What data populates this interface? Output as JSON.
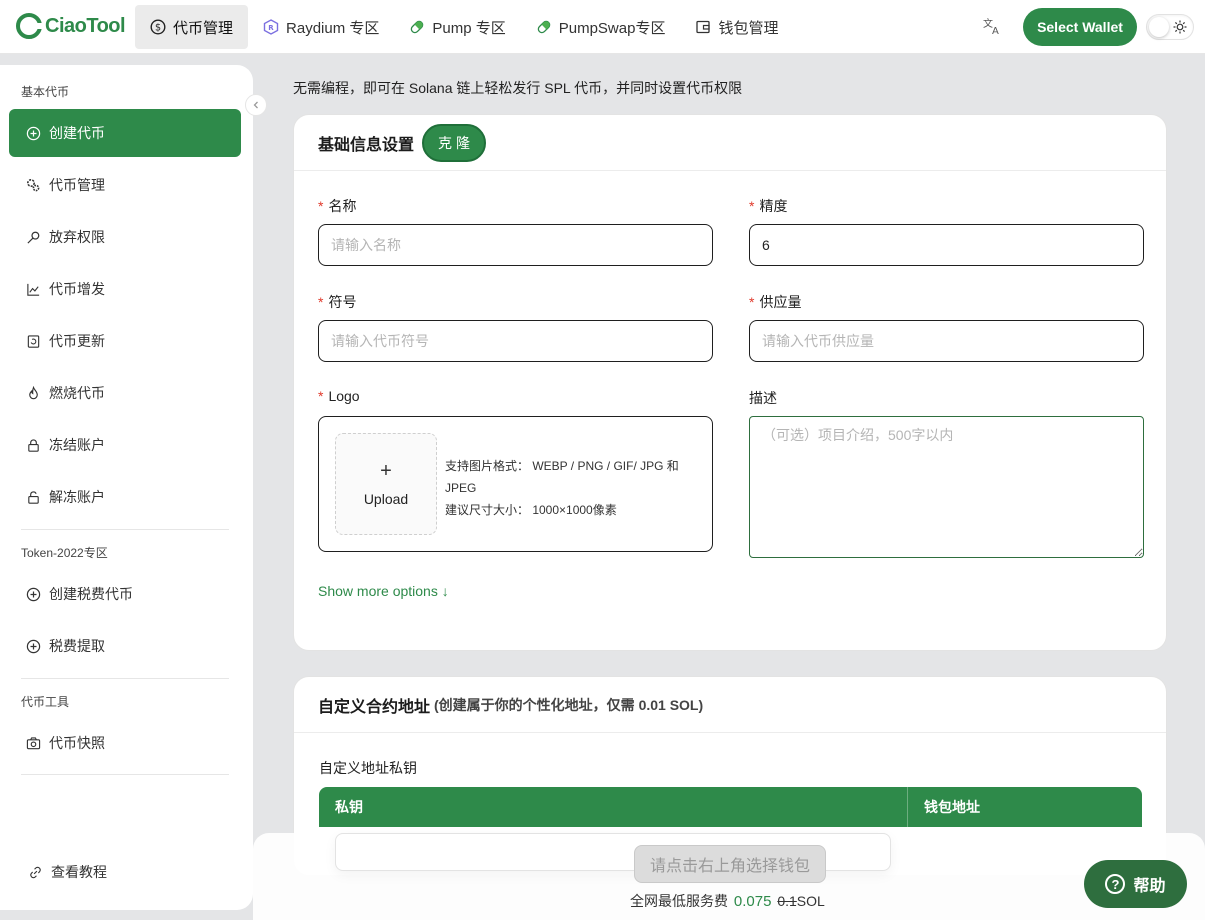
{
  "brand": {
    "name": "CiaoTool"
  },
  "nav": {
    "items": [
      {
        "label": "代币管理",
        "icon": "dollar-circle-icon"
      },
      {
        "label": "Raydium 专区",
        "icon": "raydium-icon"
      },
      {
        "label": "Pump 专区",
        "icon": "pill-icon"
      },
      {
        "label": "PumpSwap专区",
        "icon": "pill-icon"
      },
      {
        "label": "钱包管理",
        "icon": "wallet-icon"
      }
    ],
    "active_index": 0,
    "select_wallet": "Select Wallet",
    "translate_icon": "translate-icon",
    "theme_icon": "sun-icon"
  },
  "sidebar": {
    "sections": [
      "基本代币",
      "Token-2022专区",
      "代币工具"
    ],
    "basic": [
      "创建代币",
      "代币管理",
      "放弃权限",
      "代币增发",
      "代币更新",
      "燃烧代币",
      "冻结账户",
      "解冻账户"
    ],
    "token2022": [
      "创建税费代币",
      "税费提取"
    ],
    "tools": [
      "代币快照"
    ],
    "tutorial": "查看教程"
  },
  "main": {
    "intro": "无需编程，即可在 Solana 链上轻松发行 SPL 代币，并同时设置代币权限",
    "basic_card": {
      "title": "基础信息设置",
      "clone": "克隆",
      "name_label": "名称",
      "name_placeholder": "请输入名称",
      "decimals_label": "精度",
      "decimals_value": "6",
      "symbol_label": "符号",
      "symbol_placeholder": "请输入代币符号",
      "supply_label": "供应量",
      "supply_placeholder": "请输入代币供应量",
      "logo_label": "Logo",
      "upload_label": "Upload",
      "upload_hint_formats": "支持图片格式：  WEBP / PNG / GIF/ JPG 和 JPEG",
      "upload_hint_size": "建议尺寸大小：  1000×1000像素",
      "desc_label": "描述",
      "desc_placeholder": "（可选）项目介绍，500字以内",
      "more_options": "Show more options ↓"
    },
    "custom_card": {
      "title": "自定义合约地址",
      "subtitle": "(创建属于你的个性化地址，仅需 0.01 SOL)",
      "key_label": "自定义地址私钥",
      "col_key": "私钥",
      "col_address": "钱包地址"
    }
  },
  "bottom": {
    "action": "请点击右上角选择钱包",
    "fee_prefix": "全网最低服务费",
    "fee_now": "0.075",
    "fee_old": "0.1",
    "fee_unit": "SOL"
  },
  "help": {
    "label": "帮助"
  },
  "colors": {
    "accent": "#2e8a4a",
    "dark_accent": "#2e6e3e",
    "required": "#e0392b"
  }
}
